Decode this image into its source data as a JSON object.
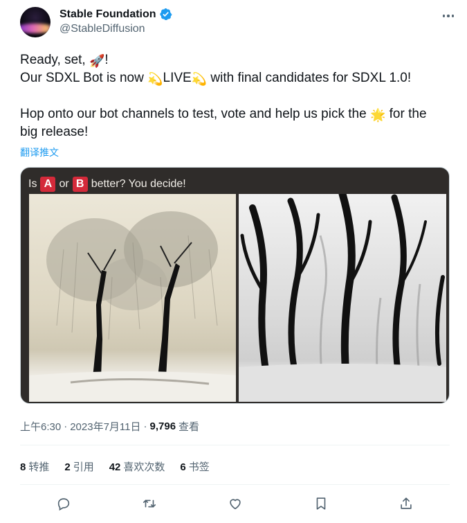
{
  "author": {
    "display_name": "Stable Foundation",
    "handle": "@StableDiffusion",
    "verified_icon": "verified-badge-icon",
    "avatar_icon": "avatar"
  },
  "menu": {
    "icon": "more-icon"
  },
  "tweet": {
    "line1_prefix": "Ready, set, ",
    "line1_emoji": "🚀",
    "line1_suffix": "!",
    "line2_prefix": "Our SDXL Bot is now ",
    "line2_emoji_a": "💫",
    "line2_live": "LIVE",
    "line2_emoji_b": "💫",
    "line2_suffix": " with final candidates for SDXL 1.0!",
    "line3_prefix": "Hop onto our bot channels to test, vote and help us pick the ",
    "line3_emoji": "🌟",
    "line3_suffix": " for the",
    "line4": "big release!",
    "translate_link": "翻译推文"
  },
  "media": {
    "caption_prefix": "Is ",
    "option_a": "A",
    "caption_or": " or ",
    "option_b": "B",
    "caption_suffix": " better? You decide!"
  },
  "meta": {
    "time": "上午6:30",
    "separator": "·",
    "date": "2023年7月11日",
    "separator2": "·",
    "views": "9,796",
    "views_label": "查看"
  },
  "stats": [
    {
      "count": "8",
      "label": "转推"
    },
    {
      "count": "2",
      "label": "引用"
    },
    {
      "count": "42",
      "label": "喜欢次数"
    },
    {
      "count": "6",
      "label": "书签"
    }
  ],
  "actions": [
    "reply-icon",
    "retweet-icon",
    "like-icon",
    "bookmark-icon",
    "share-icon"
  ],
  "colors": {
    "accent": "#1d9bf0",
    "text": "#0f1419",
    "muted": "#536471",
    "badge": "#d42a3a"
  }
}
